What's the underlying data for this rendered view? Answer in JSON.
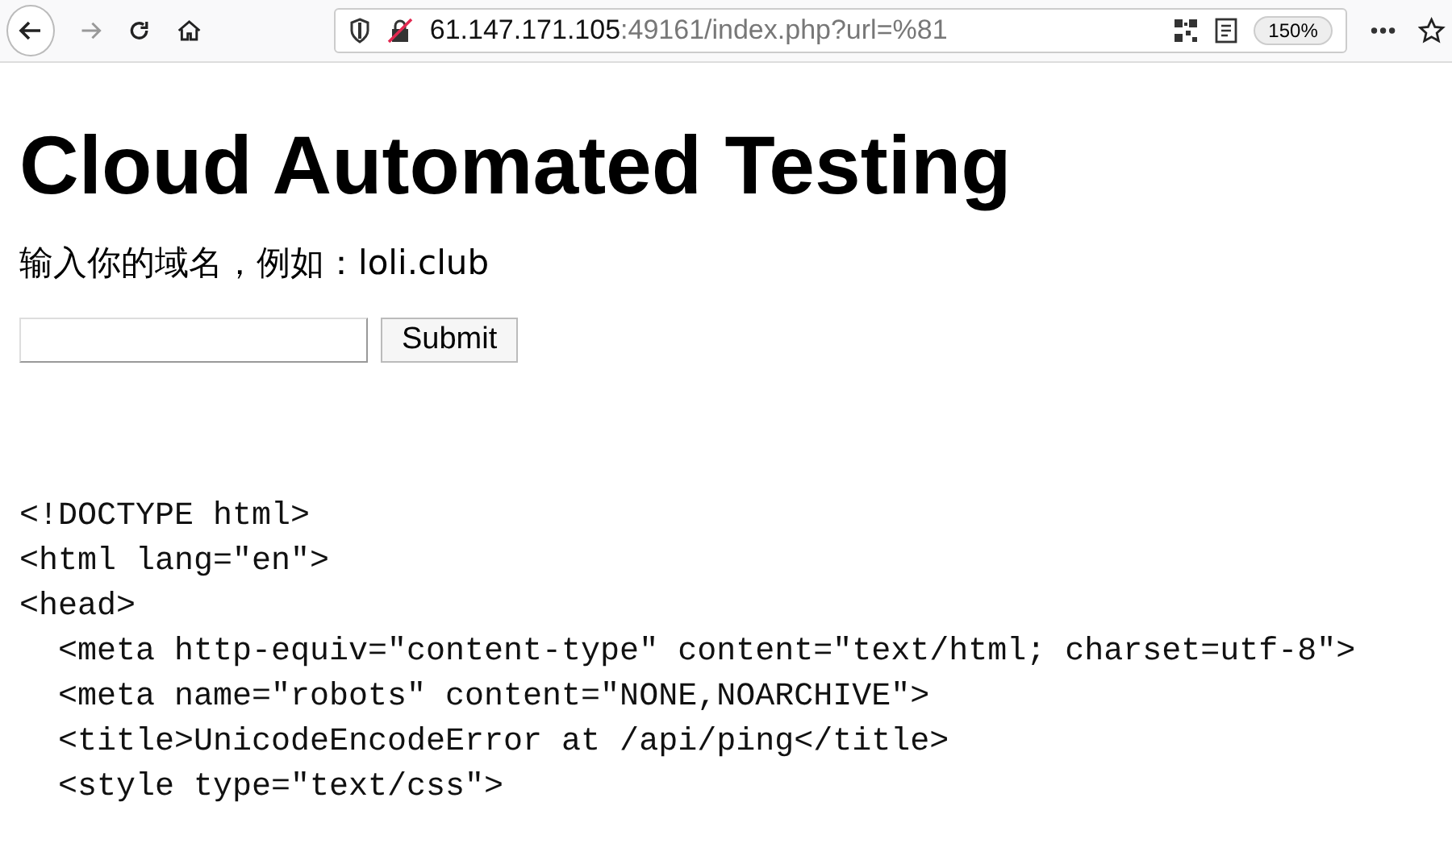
{
  "browser": {
    "url_host": "61.147.171.105",
    "url_rest": ":49161/index.php?url=%81",
    "zoom": "150%"
  },
  "page": {
    "heading": "Cloud Automated Testing",
    "prompt": "输入你的域名，例如：loli.club",
    "button": "Submit",
    "code_lines": [
      "<!DOCTYPE html>",
      "<html lang=\"en\">",
      "<head>",
      "  <meta http-equiv=\"content-type\" content=\"text/html; charset=utf-8\">",
      "  <meta name=\"robots\" content=\"NONE,NOARCHIVE\">",
      "  <title>UnicodeEncodeError at /api/ping</title>",
      "  <style type=\"text/css\">"
    ]
  }
}
